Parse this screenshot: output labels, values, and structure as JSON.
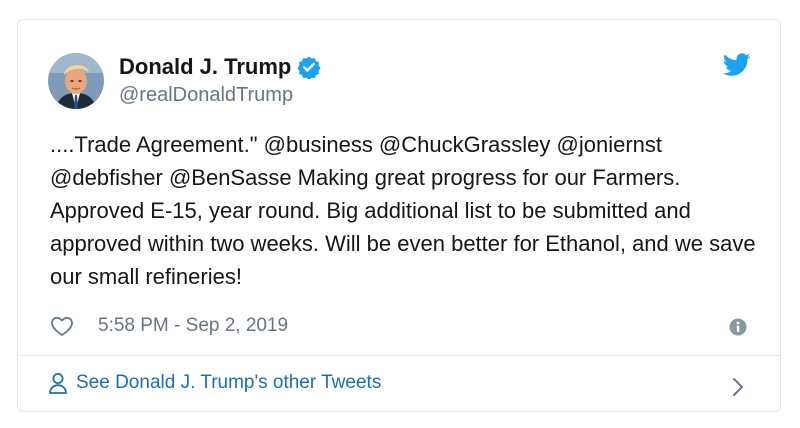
{
  "tweet": {
    "author_name": "Donald J. Trump",
    "handle": "@realDonaldTrump",
    "text": "....Trade Agreement.\" @business @ChuckGrassley @joniernst @debfisher @BenSasse Making great progress for our Farmers. Approved E-15, year round. Big additional list to be submitted and approved within two weeks. Will be even better for Ethanol, and we save our small refineries!",
    "timestamp": "5:58 PM - Sep 2, 2019"
  },
  "footer": {
    "link_label": "See Donald J. Trump's other Tweets"
  },
  "icons": {
    "brand": "twitter-bird-icon",
    "verified": "verified-badge-icon",
    "like": "heart-icon",
    "info": "info-icon",
    "profile": "person-icon",
    "more": "chevron-right-icon"
  },
  "colors": {
    "twitter_blue": "#1da1f2",
    "link_blue": "#1b6fb0",
    "secondary_text": "#657786",
    "border": "#e1e8ed"
  }
}
